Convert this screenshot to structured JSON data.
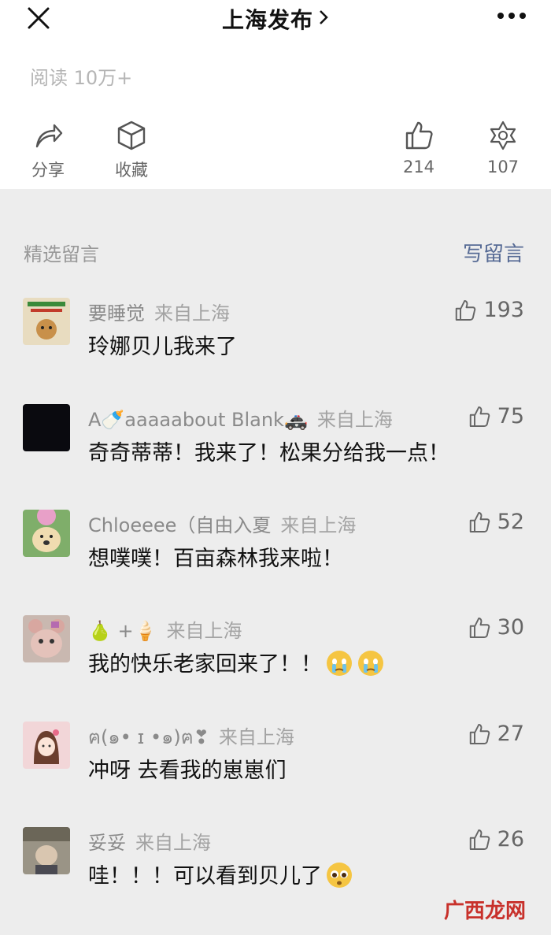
{
  "header": {
    "title": "上海发布"
  },
  "stats": {
    "read_label": "阅读 10万+"
  },
  "actions": {
    "share": "分享",
    "favorite": "收藏",
    "like_count": "214",
    "wow_count": "107"
  },
  "comments_section": {
    "title": "精选留言",
    "write": "写留言"
  },
  "comments": [
    {
      "name": "要睡觉",
      "location": "来自上海",
      "text": "玲娜贝儿我来了",
      "likes": "193"
    },
    {
      "name": "A🍼aaaaabout Blank🚓",
      "location": "来自上海",
      "text": "奇奇蒂蒂！我来了！松果分给我一点！",
      "likes": "75"
    },
    {
      "name": "Chloeeee（自由入夏",
      "location": "来自上海",
      "text": "想噗噗！百亩森林我来啦！",
      "likes": "52"
    },
    {
      "name": "🍐 +🍦",
      "location": "来自上海",
      "text": "我的快乐老家回来了！！",
      "likes": "30"
    },
    {
      "name": "ฅ(๑• ɪ •๑)ฅ❣",
      "location": "来自上海",
      "text": "冲呀 去看我的崽崽们",
      "likes": "27"
    },
    {
      "name": "妥妥",
      "location": "来自上海",
      "text": "哇！！！可以看到贝儿了",
      "likes": "26"
    }
  ],
  "watermark": "广西龙网"
}
